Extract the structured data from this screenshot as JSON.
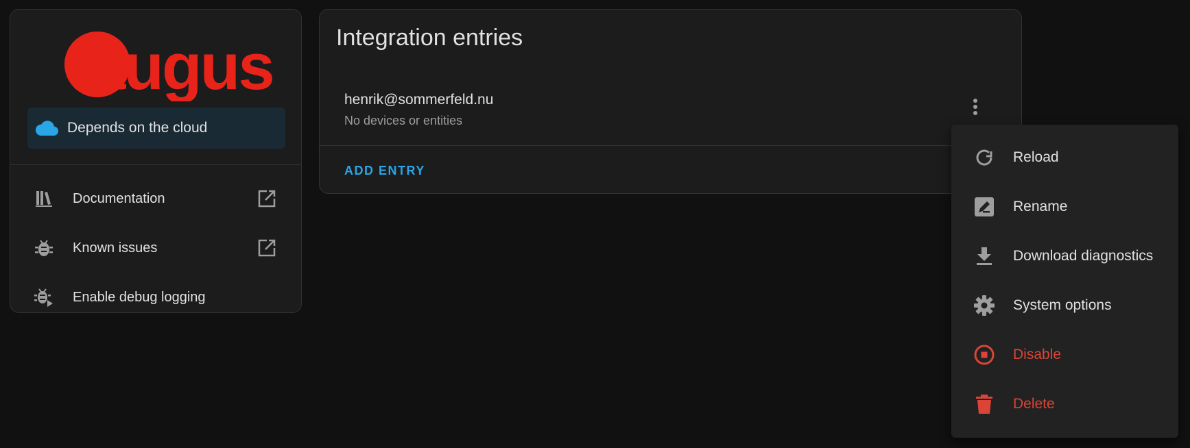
{
  "info": {
    "brand_logo_text": "august",
    "cloud_badge": {
      "label": "Depends on the cloud",
      "icon": "cloud-icon"
    },
    "links": [
      {
        "label": "Documentation",
        "icon": "book-shelf-icon",
        "trail_icon": "open-in-new-icon"
      },
      {
        "label": "Known issues",
        "icon": "bug-icon",
        "trail_icon": "open-in-new-icon"
      },
      {
        "label": "Enable debug logging",
        "icon": "bug-play-icon"
      }
    ]
  },
  "entries": {
    "title": "Integration entries",
    "items": [
      {
        "email": "henrik@sommerfeld.nu",
        "subtitle": "No devices or entities",
        "menu_icon": "dots-vertical-icon"
      }
    ],
    "add_entry_label": "ADD ENTRY"
  },
  "menu": {
    "items": [
      {
        "label": "Reload",
        "icon": "reload-icon",
        "danger": false
      },
      {
        "label": "Rename",
        "icon": "rename-icon",
        "danger": false
      },
      {
        "label": "Download diagnostics",
        "icon": "download-icon",
        "danger": false
      },
      {
        "label": "System options",
        "icon": "gear-icon",
        "danger": false
      },
      {
        "label": "Disable",
        "icon": "stop-circle-icon",
        "danger": true
      },
      {
        "label": "Delete",
        "icon": "trash-icon",
        "danger": true
      }
    ]
  },
  "colors": {
    "background": "#111111",
    "card": "#1c1c1c",
    "brand_red": "#e8231a",
    "accent_blue": "#2aa5e6",
    "danger": "#db4437",
    "icon_grey": "#9e9e9e"
  }
}
